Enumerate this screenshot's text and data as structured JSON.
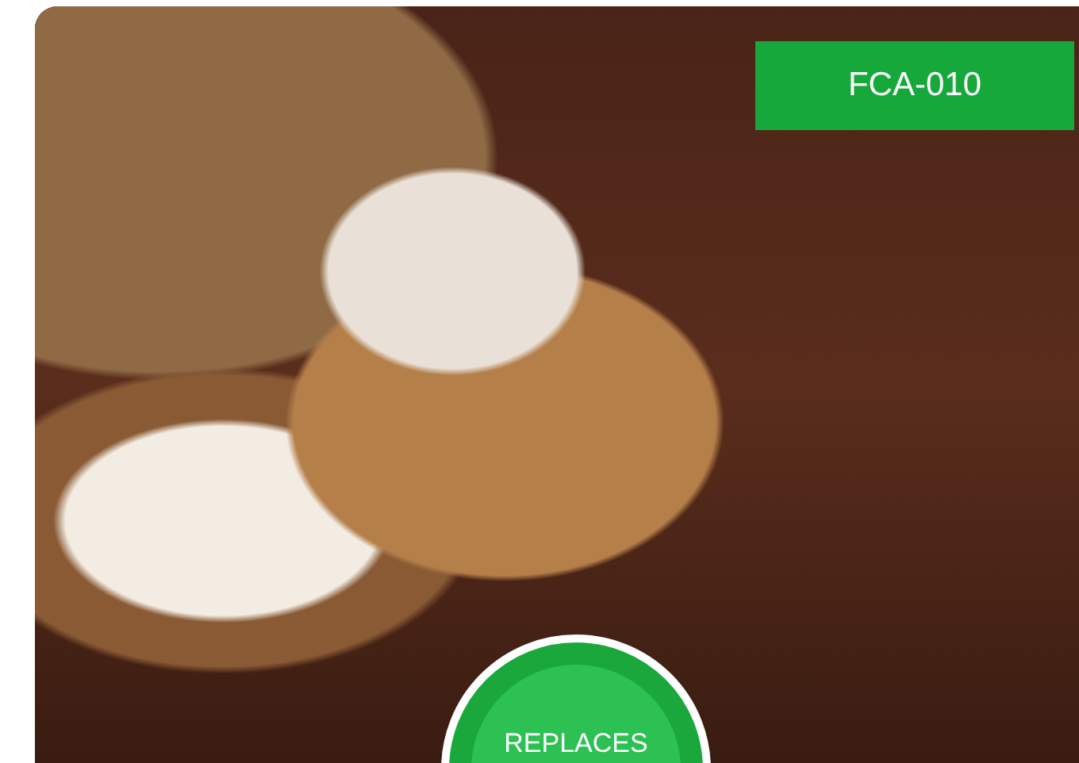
{
  "product_card": {
    "code_badge": "FCA-010",
    "replaces_badge": "REPLACES"
  }
}
